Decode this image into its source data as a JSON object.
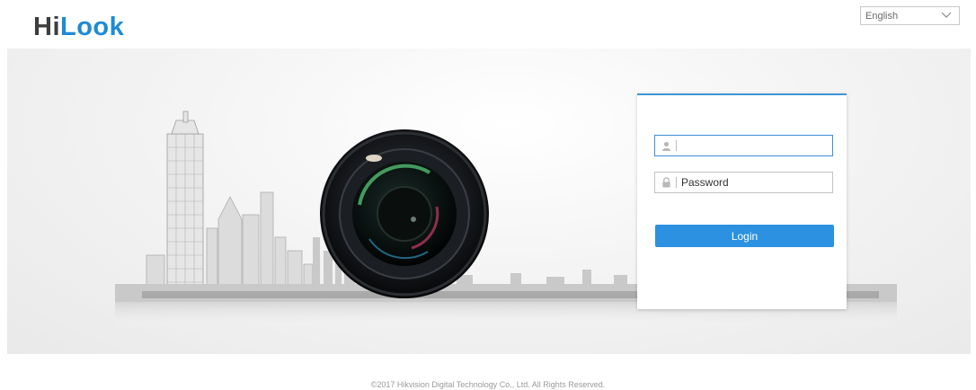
{
  "brand": {
    "logo_hi": "Hi",
    "logo_look": "Look"
  },
  "language": {
    "selected": "English"
  },
  "login": {
    "username_value": "",
    "password_placeholder": "Password",
    "button_label": "Login"
  },
  "footer": {
    "copyright": "©2017 Hikvision Digital Technology Co., Ltd. All Rights Reserved."
  },
  "colors": {
    "accent": "#2c91e0",
    "logo_blue": "#1f8ad6",
    "card_border": "#3f95d6"
  }
}
